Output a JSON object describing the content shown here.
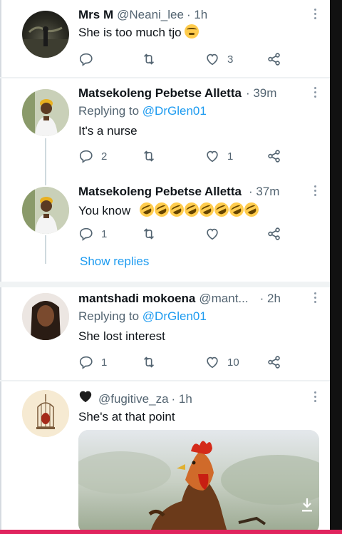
{
  "tweets": [
    {
      "name": "Mrs M",
      "handle": "@Neani_lee",
      "time": "· 1h",
      "text": "She is too much tjo",
      "actions": {
        "reply": "",
        "retweet": "",
        "like": "3"
      }
    },
    {
      "name": "Matsekoleng Pebetse Alletta",
      "time": "· 39m",
      "replying_prefix": "Replying to",
      "replying_to": "@DrGlen01",
      "text": "It's a nurse",
      "actions": {
        "reply": "2",
        "retweet": "",
        "like": "1"
      }
    },
    {
      "name": "Matsekoleng Pebetse Alletta",
      "time": "· 37m",
      "text": "You know",
      "actions": {
        "reply": "1",
        "retweet": "",
        "like": ""
      },
      "show_replies": "Show replies"
    },
    {
      "name": "mantshadi mokoena",
      "handle": "@mant...",
      "time": "· 2h",
      "replying_prefix": "Replying to",
      "replying_to": "@DrGlen01",
      "text": "She lost interest",
      "actions": {
        "reply": "1",
        "retweet": "",
        "like": "10"
      }
    },
    {
      "handle": "@fugitive_za",
      "time": "· 1h",
      "text": "She's at that point"
    }
  ],
  "colors": {
    "link": "#1d9bf0",
    "muted": "#536471",
    "text": "#0f1419",
    "divider": "#f0f3f4",
    "bottom_bar": "#e0245e"
  },
  "icons": [
    "reply-icon",
    "retweet-icon",
    "like-icon",
    "share-icon",
    "more-icon",
    "download-icon",
    "black-heart-icon"
  ]
}
